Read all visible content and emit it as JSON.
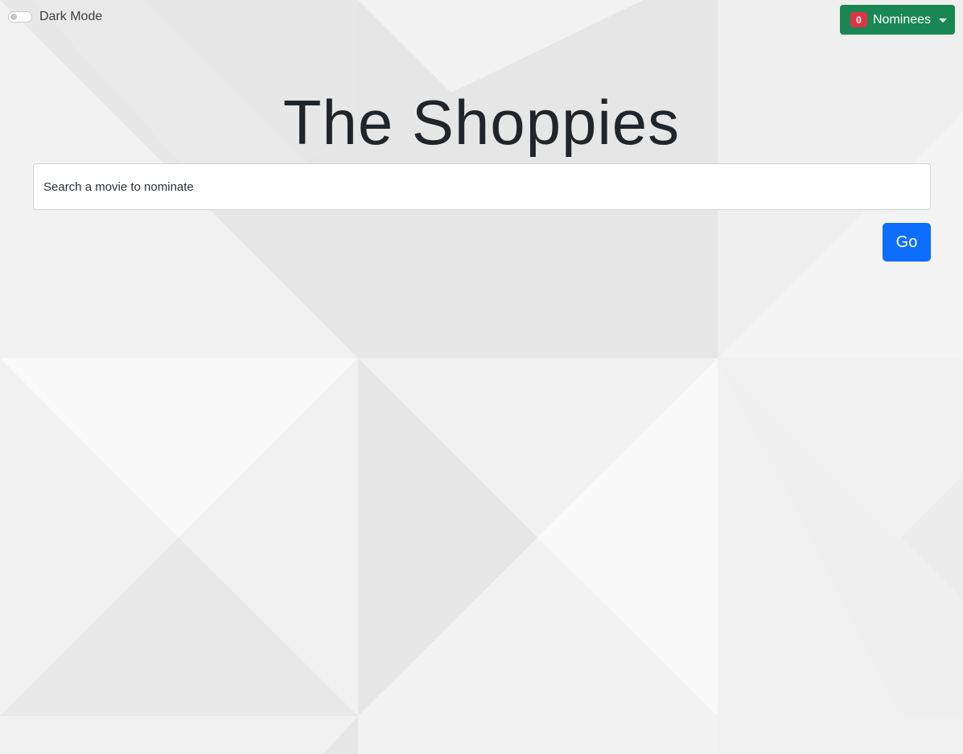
{
  "dark_mode": {
    "label": "Dark Mode",
    "enabled": false,
    "icon": "toggle-switch-icon"
  },
  "nominees": {
    "count": "0",
    "label": "Nominees",
    "icon": "caret-down-icon",
    "colors": {
      "button": "#198754",
      "badge": "#dc3545"
    }
  },
  "header": {
    "title": "The Shoppies"
  },
  "search": {
    "placeholder": "Search a movie to nominate",
    "value": ""
  },
  "actions": {
    "go_label": "Go",
    "go_color": "#0d6efd"
  }
}
